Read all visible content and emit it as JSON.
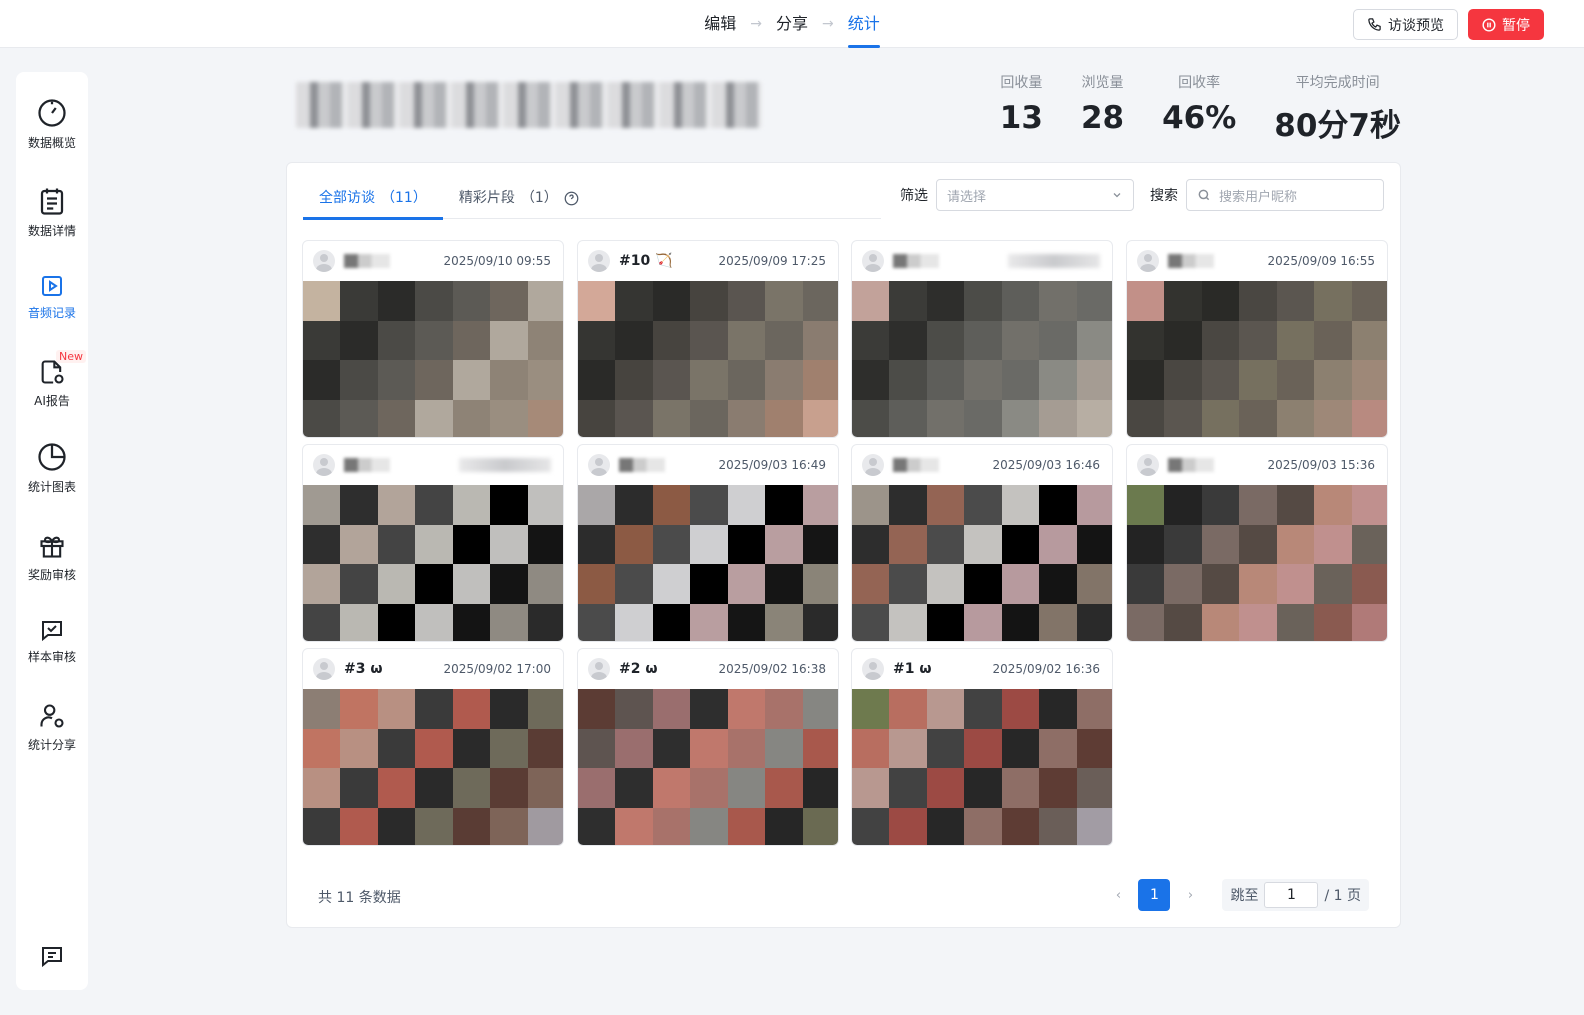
{
  "steps": [
    "编辑",
    "分享",
    "统计"
  ],
  "top_actions": {
    "preview": "访谈预览",
    "pause": "暂停"
  },
  "sidebar": {
    "items": [
      {
        "label": "数据概览",
        "icon": "gauge-icon"
      },
      {
        "label": "数据详情",
        "icon": "clipboard-list-icon"
      },
      {
        "label": "音频记录",
        "icon": "play-square-icon"
      },
      {
        "label": "AI报告",
        "icon": "file-gear-icon",
        "badge": "New"
      },
      {
        "label": "统计图表",
        "icon": "pie-chart-icon"
      },
      {
        "label": "奖励审核",
        "icon": "gift-icon"
      },
      {
        "label": "样本审核",
        "icon": "check-message-icon"
      },
      {
        "label": "统计分享",
        "icon": "user-share-icon"
      }
    ],
    "feedback_icon": "message-icon"
  },
  "stats": [
    {
      "label": "回收量",
      "value": "13"
    },
    {
      "label": "浏览量",
      "value": "28"
    },
    {
      "label": "回收率",
      "value": "46%"
    },
    {
      "label": "平均完成时间",
      "value": "80分7秒"
    }
  ],
  "tabs": [
    {
      "label": "全部访谈",
      "count": "（11）"
    },
    {
      "label": "精彩片段",
      "count": "（1）"
    }
  ],
  "filter": {
    "label": "筛选",
    "placeholder": "请选择"
  },
  "search": {
    "label": "搜索",
    "placeholder": "搜索用户昵称"
  },
  "cards": [
    {
      "name": "",
      "time": "2025/09/10 09:55"
    },
    {
      "name": "#10 🏹",
      "time": "2025/09/09 17:25"
    },
    {
      "name": "",
      "time": ""
    },
    {
      "name": "",
      "time": "2025/09/09 16:55"
    },
    {
      "name": "",
      "time": ""
    },
    {
      "name": "",
      "time": "2025/09/03 16:49"
    },
    {
      "name": "",
      "time": "2025/09/03 16:46"
    },
    {
      "name": "",
      "time": "2025/09/03 15:36"
    },
    {
      "name": "#3 ω",
      "time": "2025/09/02 17:00"
    },
    {
      "name": "#2 ω",
      "time": "2025/09/02 16:38"
    },
    {
      "name": "#1 ω",
      "time": "2025/09/02 16:36"
    }
  ],
  "pagination": {
    "total": "共 11 条数据",
    "current": "1",
    "jump_label": "跳至",
    "jump_value": "1",
    "total_pages": "/ 1 页"
  },
  "colors": {
    "accent": "#1a73e8",
    "danger": "#f5363f"
  }
}
